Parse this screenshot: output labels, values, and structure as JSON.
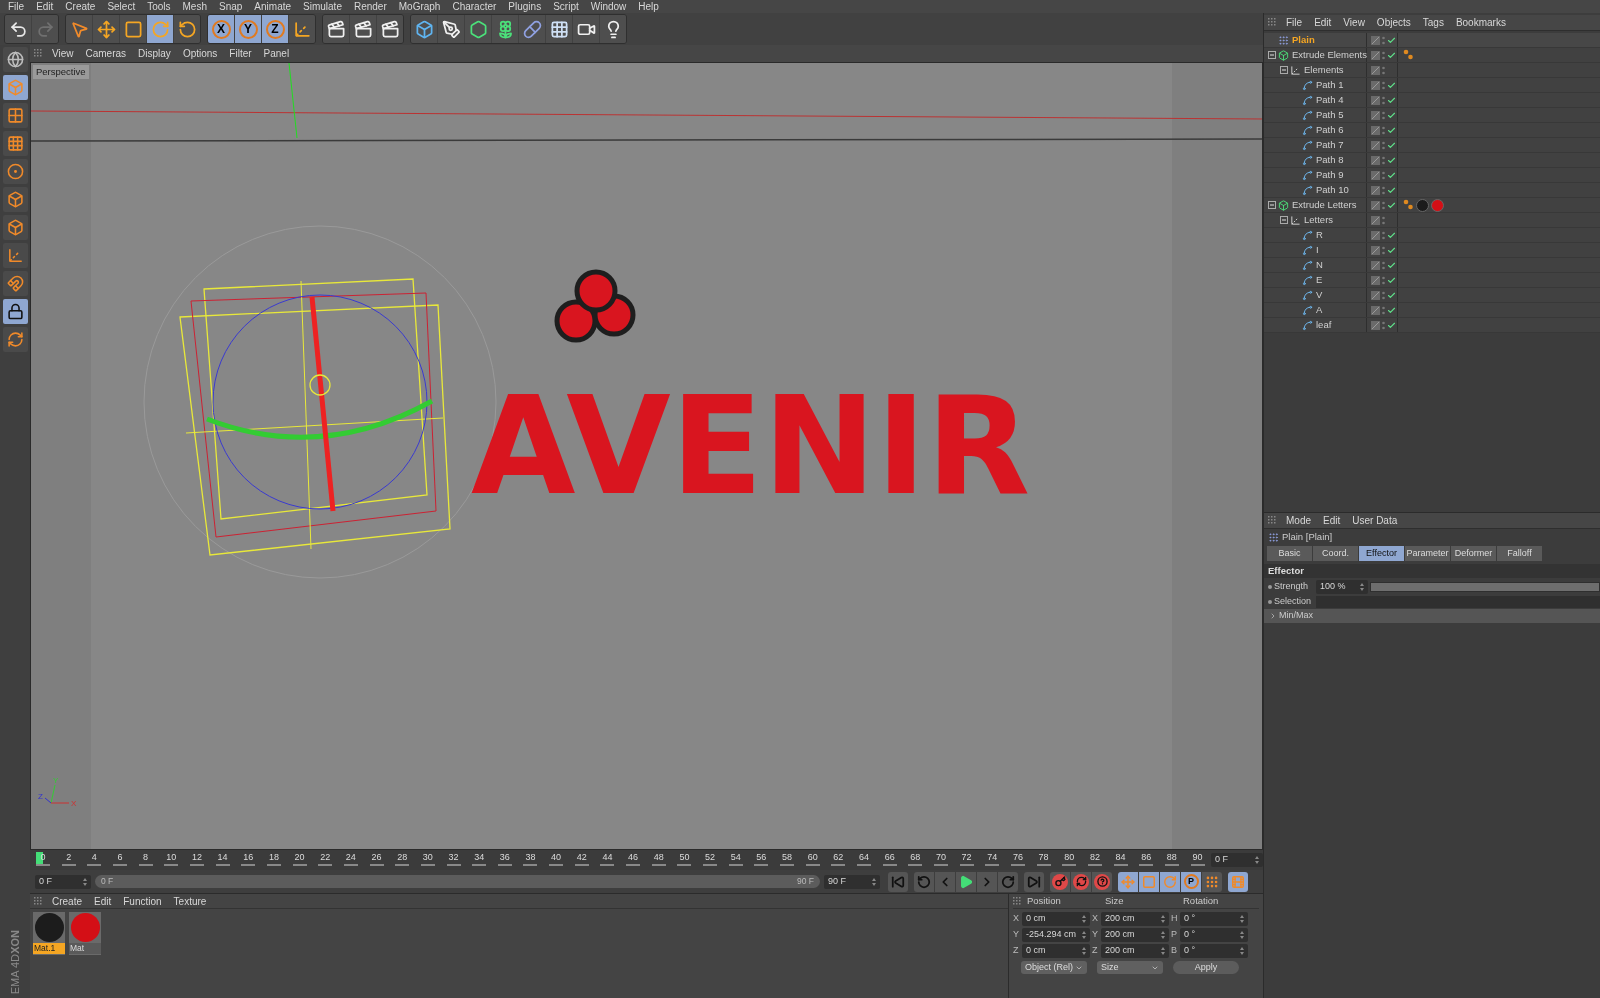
{
  "menubar": [
    "File",
    "Edit",
    "Create",
    "Select",
    "Tools",
    "Mesh",
    "Snap",
    "Animate",
    "Simulate",
    "Render",
    "MoGraph",
    "Character",
    "Plugins",
    "Script",
    "Window",
    "Help"
  ],
  "toolbar": [
    {
      "tools": [
        {
          "kind": "undo",
          "selected": false,
          "disabled": false
        },
        {
          "kind": "redo",
          "selected": false,
          "disabled": true
        }
      ]
    },
    {
      "tools": [
        {
          "kind": "live_selection",
          "selected": false,
          "disabled": false
        },
        {
          "kind": "move",
          "selected": false,
          "disabled": false
        },
        {
          "kind": "scale",
          "selected": false,
          "disabled": false
        },
        {
          "kind": "rotate",
          "selected": true,
          "disabled": false
        },
        {
          "kind": "recent",
          "selected": false,
          "disabled": false
        }
      ]
    },
    {
      "tools": [
        {
          "kind": "axis_lock",
          "label": "X",
          "selected": true,
          "disabled": false
        },
        {
          "kind": "axis_lock",
          "label": "Y",
          "selected": true,
          "disabled": false
        },
        {
          "kind": "axis_lock",
          "label": "Z",
          "selected": true,
          "disabled": false
        },
        {
          "kind": "coord_system",
          "selected": false,
          "disabled": false
        }
      ]
    },
    {
      "tools": [
        {
          "kind": "render",
          "selected": false,
          "disabled": false
        },
        {
          "kind": "render",
          "selected": false,
          "disabled": false
        },
        {
          "kind": "render",
          "selected": false,
          "disabled": false
        }
      ]
    },
    {
      "tools": [
        {
          "kind": "cube",
          "selected": false,
          "disabled": false
        },
        {
          "kind": "pen",
          "selected": false,
          "disabled": false
        },
        {
          "kind": "subdivision",
          "selected": false,
          "disabled": false
        },
        {
          "kind": "cloner",
          "selected": false,
          "disabled": false
        },
        {
          "kind": "deformer",
          "selected": false,
          "disabled": false
        },
        {
          "kind": "floor",
          "selected": false,
          "disabled": false
        },
        {
          "kind": "camera",
          "selected": false,
          "disabled": false
        },
        {
          "kind": "light",
          "selected": false,
          "disabled": false
        }
      ]
    }
  ],
  "left_tools": [
    {
      "kind": "viewport",
      "selected": false
    },
    {
      "kind": "model",
      "selected": true
    },
    {
      "kind": "texture",
      "selected": false
    },
    {
      "kind": "workplane",
      "selected": false
    },
    {
      "kind": "points",
      "selected": false
    },
    {
      "kind": "edges",
      "selected": false
    },
    {
      "kind": "polygons",
      "selected": false
    },
    {
      "kind": "axis",
      "selected": false
    },
    {
      "kind": "magnet",
      "selected": false
    },
    {
      "kind": "grid_lock",
      "selected": true
    },
    {
      "kind": "grid_rotate",
      "selected": false
    }
  ],
  "logo": [
    "XON",
    "EMA 4D"
  ],
  "viewport": {
    "menu": [
      "View",
      "Cameras",
      "Display",
      "Options",
      "Filter",
      "Panel"
    ],
    "label": "Perspective",
    "scene_text": "AVENIR",
    "gizmo_labels": [
      "Y",
      "Z",
      "X"
    ]
  },
  "timeline": {
    "ticks": [
      "0",
      "2",
      "4",
      "6",
      "8",
      "10",
      "12",
      "14",
      "16",
      "18",
      "20",
      "22",
      "24",
      "26",
      "28",
      "30",
      "32",
      "34",
      "36",
      "38",
      "40",
      "42",
      "44",
      "46",
      "48",
      "50",
      "52",
      "54",
      "56",
      "58",
      "60",
      "62",
      "64",
      "66",
      "68",
      "70",
      "72",
      "74",
      "76",
      "78",
      "80",
      "82",
      "84",
      "86",
      "88",
      "90"
    ],
    "current_frame": "0 F",
    "start": "0 F",
    "range_start": "0 F",
    "range_end": "90 F",
    "end": "90 F",
    "playback": [
      {
        "kind": "first"
      },
      {
        "kind": "prev_key"
      },
      {
        "kind": "prev_frame"
      },
      {
        "kind": "play"
      },
      {
        "kind": "next_frame"
      },
      {
        "kind": "next_key"
      },
      {
        "kind": "last"
      }
    ],
    "record": [
      {
        "kind": "record"
      },
      {
        "kind": "autokey"
      },
      {
        "kind": "keyset"
      }
    ],
    "key_modes": [
      {
        "kind": "move",
        "selected": true
      },
      {
        "kind": "scale",
        "selected": true
      },
      {
        "kind": "rotate",
        "selected": true
      },
      {
        "kind": "param",
        "label": "P",
        "selected": true
      },
      {
        "kind": "pla",
        "selected": false
      }
    ],
    "timeline_button": {
      "selected": true
    }
  },
  "materials": {
    "menu": [
      "Create",
      "Edit",
      "Function",
      "Texture"
    ],
    "items": [
      {
        "name": "Mat.1",
        "color": "#1c1c1c",
        "selected": true
      },
      {
        "name": "Mat",
        "color": "#d40f16",
        "selected": false
      }
    ]
  },
  "coordinates": {
    "headers": [
      "Position",
      "Size",
      "Rotation"
    ],
    "columns": [
      [
        {
          "axis": "X",
          "value": "0 cm"
        },
        {
          "axis": "Y",
          "value": "-254.294 cm"
        },
        {
          "axis": "Z",
          "value": "0 cm"
        }
      ],
      [
        {
          "axis": "X",
          "value": "200 cm"
        },
        {
          "axis": "Y",
          "value": "200 cm"
        },
        {
          "axis": "Z",
          "value": "200 cm"
        }
      ],
      [
        {
          "axis": "H",
          "value": "0 °"
        },
        {
          "axis": "P",
          "value": "0 °"
        },
        {
          "axis": "B",
          "value": "0 °"
        }
      ]
    ],
    "mode_dropdown": "Object (Rel)",
    "size_dropdown": "Size",
    "apply": "Apply"
  },
  "object_manager": {
    "menu": [
      "File",
      "Edit",
      "View",
      "Objects",
      "Tags",
      "Bookmarks"
    ],
    "objects": [
      {
        "name": "Plain",
        "kind": "effector",
        "selected": true,
        "enabled": true
      },
      {
        "name": "Extrude Elements",
        "kind": "extrude",
        "selected": false,
        "enabled": true,
        "expanded": true,
        "tags": [
          {
            "kind": "phong"
          }
        ],
        "children": [
          {
            "name": "Elements",
            "kind": "null",
            "selected": false,
            "enabled": false,
            "expanded": true,
            "children": [
              {
                "name": "Path 1",
                "kind": "spline",
                "selected": false,
                "enabled": true
              },
              {
                "name": "Path 4",
                "kind": "spline",
                "selected": false,
                "enabled": true
              },
              {
                "name": "Path 5",
                "kind": "spline",
                "selected": false,
                "enabled": true
              },
              {
                "name": "Path 6",
                "kind": "spline",
                "selected": false,
                "enabled": true
              },
              {
                "name": "Path 7",
                "kind": "spline",
                "selected": false,
                "enabled": true
              },
              {
                "name": "Path 8",
                "kind": "spline",
                "selected": false,
                "enabled": true
              },
              {
                "name": "Path 9",
                "kind": "spline",
                "selected": false,
                "enabled": true
              },
              {
                "name": "Path 10",
                "kind": "spline",
                "selected": false,
                "enabled": true
              }
            ]
          }
        ]
      },
      {
        "name": "Extrude Letters",
        "kind": "extrude",
        "selected": false,
        "enabled": true,
        "expanded": true,
        "tags": [
          {
            "kind": "phong"
          },
          {
            "kind": "material",
            "color": "#1c1c1c"
          },
          {
            "kind": "material",
            "color": "#d40f16"
          }
        ],
        "children": [
          {
            "name": "Letters",
            "kind": "null",
            "selected": false,
            "enabled": false,
            "expanded": true,
            "children": [
              {
                "name": "R",
                "kind": "spline",
                "selected": false,
                "enabled": true
              },
              {
                "name": "I",
                "kind": "spline",
                "selected": false,
                "enabled": true
              },
              {
                "name": "N",
                "kind": "spline",
                "selected": false,
                "enabled": true
              },
              {
                "name": "E",
                "kind": "spline",
                "selected": false,
                "enabled": true
              },
              {
                "name": "V",
                "kind": "spline",
                "selected": false,
                "enabled": true
              },
              {
                "name": "A",
                "kind": "spline",
                "selected": false,
                "enabled": true
              },
              {
                "name": "leaf",
                "kind": "spline",
                "selected": false,
                "enabled": true
              }
            ]
          }
        ]
      }
    ]
  },
  "attributes": {
    "menu": [
      "Mode",
      "Edit",
      "User Data"
    ],
    "title": "Plain [Plain]",
    "tabs": [
      {
        "label": "Basic",
        "selected": false
      },
      {
        "label": "Coord.",
        "selected": false
      },
      {
        "label": "Effector",
        "selected": true
      },
      {
        "label": "Parameter",
        "selected": false
      },
      {
        "label": "Deformer",
        "selected": false
      },
      {
        "label": "Falloff",
        "selected": false
      }
    ],
    "section": "Effector",
    "strength": {
      "label": "Strength",
      "value": "100 %",
      "level": 1.0
    },
    "selection": {
      "label": "Selection"
    },
    "minmax": {
      "label": "Min/Max",
      "expanded": false
    }
  }
}
